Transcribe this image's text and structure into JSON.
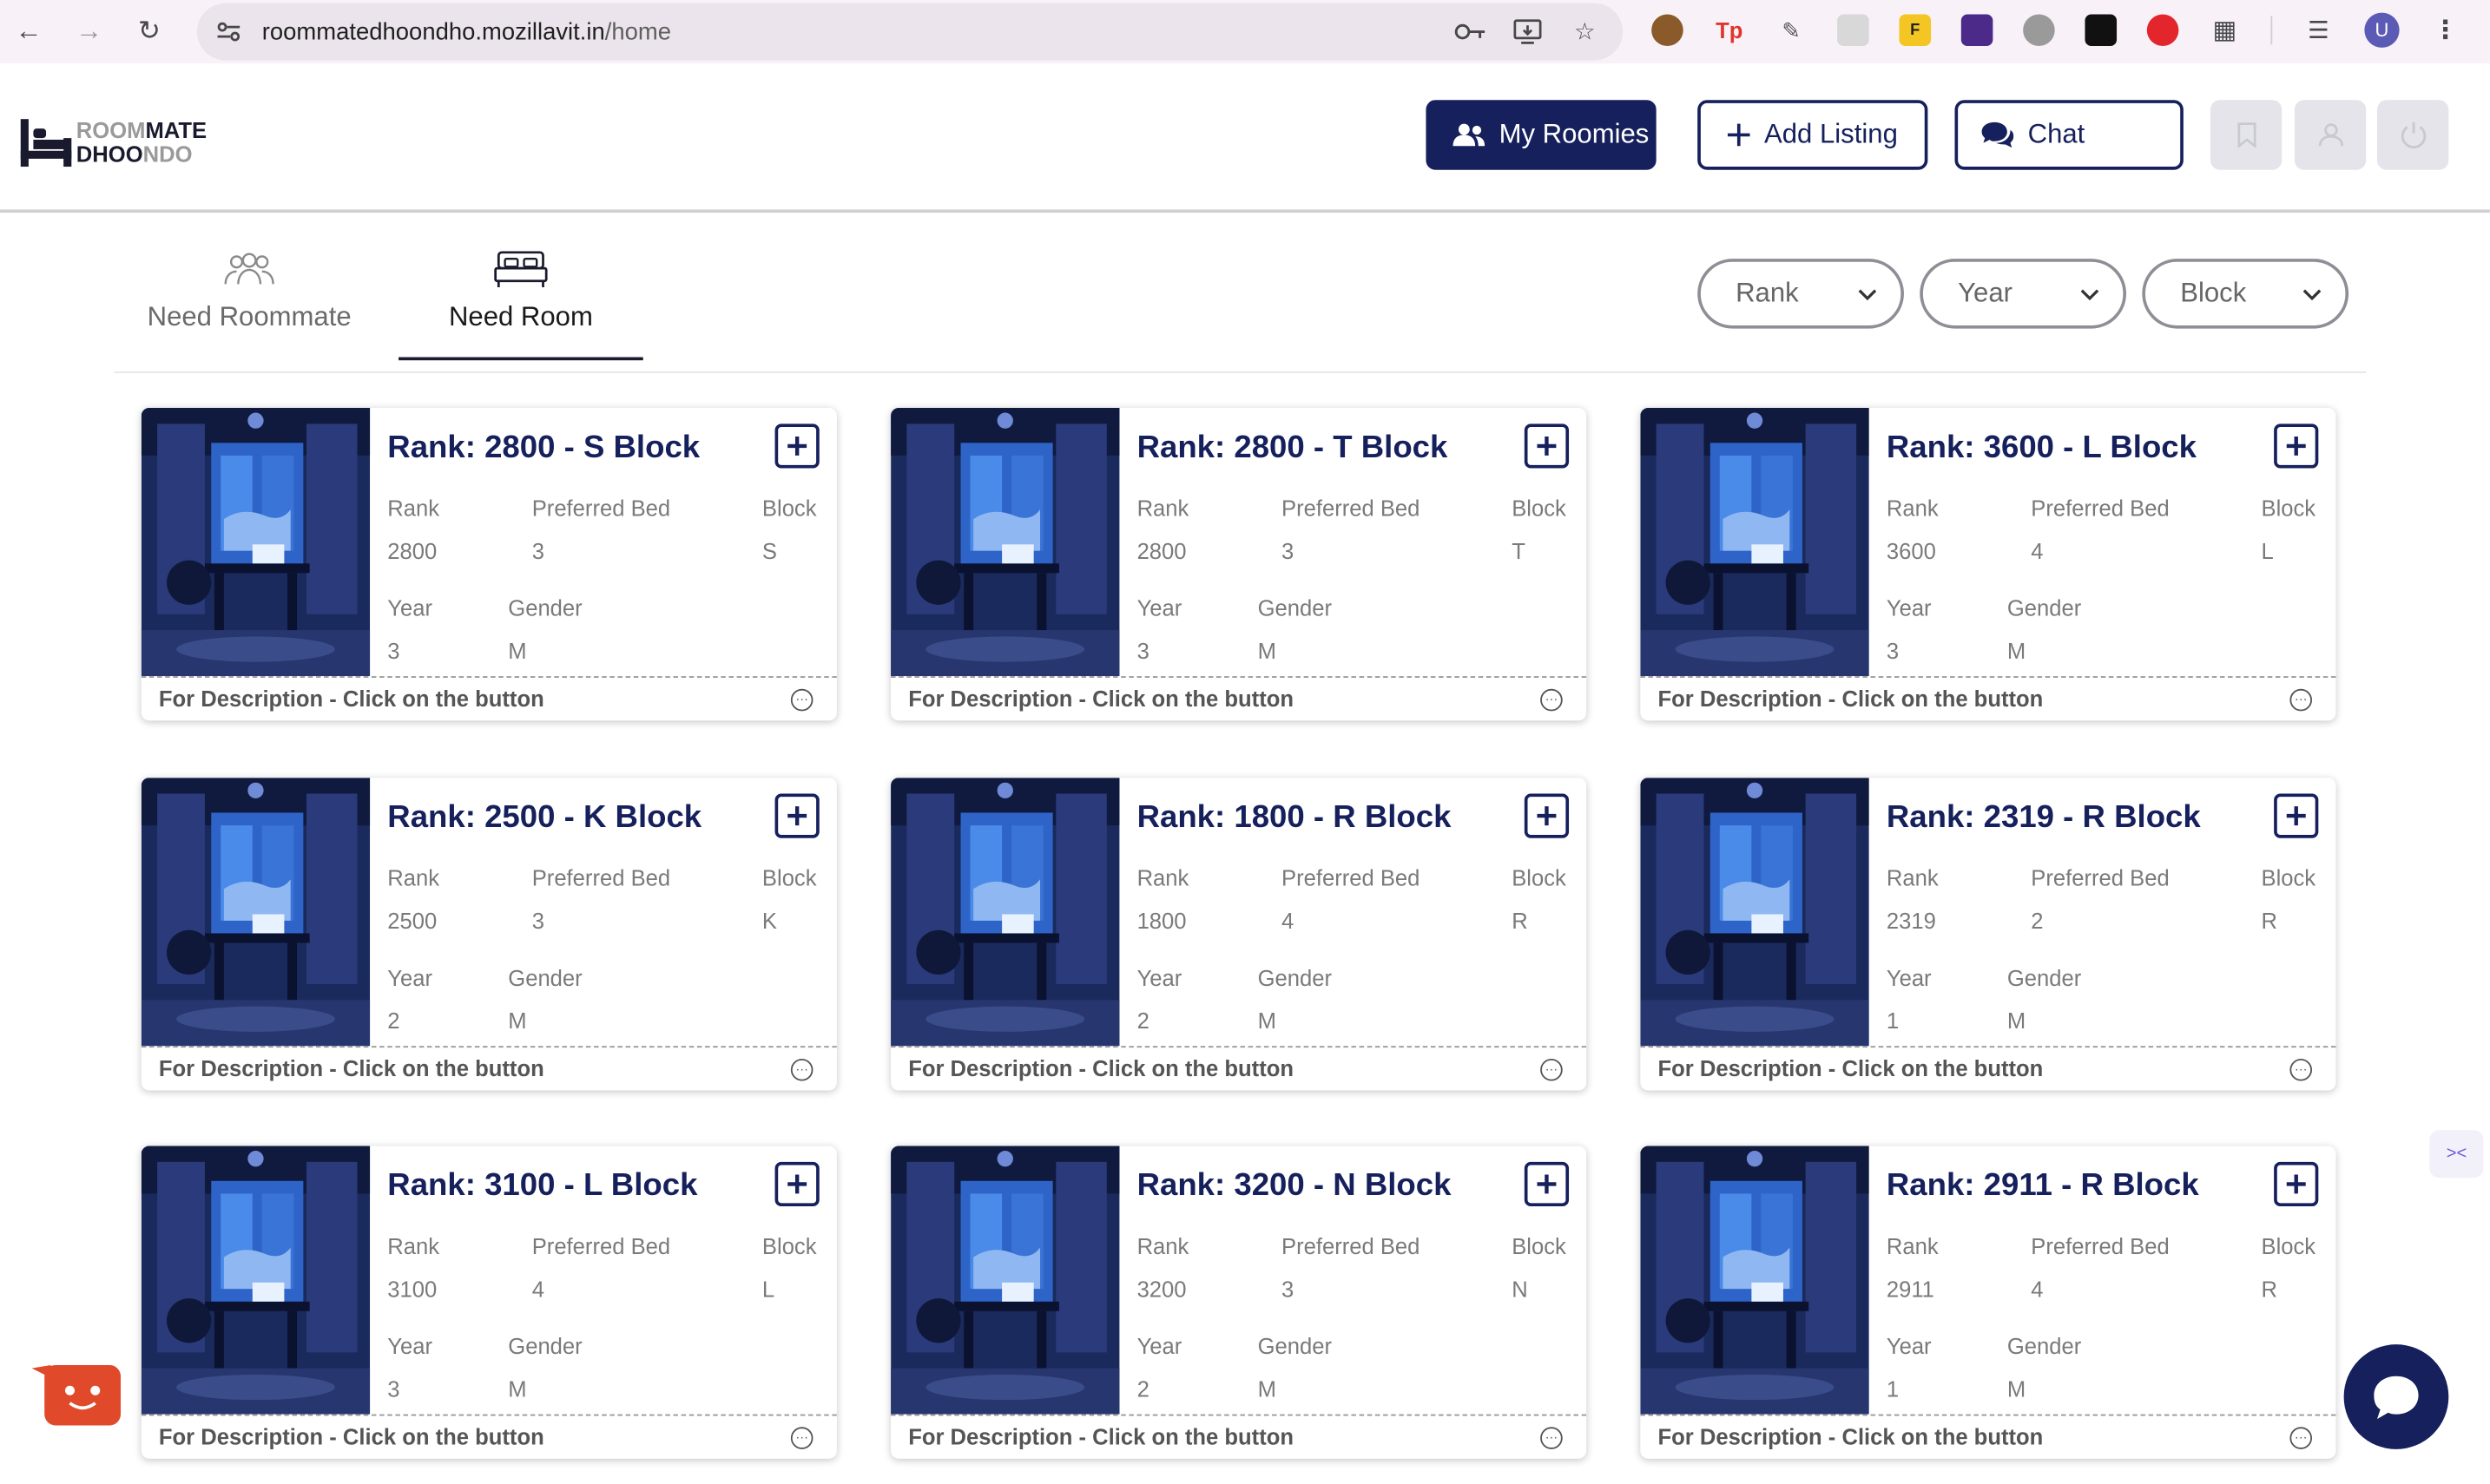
{
  "browser": {
    "url_host": "roommatedhoondho.mozillavit.in",
    "url_path": "/home",
    "profile_initial": "U"
  },
  "app": {
    "logo": {
      "line1_a": "ROOM",
      "line1_b": "MATE",
      "line2_a": "DHOO",
      "line2_b": "NDO"
    },
    "buttons": {
      "my_roomies": "My Roomies",
      "add_listing": "Add Listing",
      "chat": "Chat"
    },
    "colors": {
      "primary": "#15205c",
      "muted": "#e4e4ea"
    }
  },
  "tabs": [
    {
      "label": "Need Roommate",
      "active": false
    },
    {
      "label": "Need Room",
      "active": true
    }
  ],
  "filters": [
    {
      "label": "Rank"
    },
    {
      "label": "Year"
    },
    {
      "label": "Block"
    }
  ],
  "card_labels": {
    "rank": "Rank",
    "bed": "Preferred Bed",
    "block": "Block",
    "year": "Year",
    "gender": "Gender",
    "footer": "For Description - Click on the button"
  },
  "cards": [
    {
      "title": "Rank: 2800 - S Block",
      "rank": "2800",
      "bed": "3",
      "block": "S",
      "year": "3",
      "gender": "M"
    },
    {
      "title": "Rank: 2800 - T Block",
      "rank": "2800",
      "bed": "3",
      "block": "T",
      "year": "3",
      "gender": "M"
    },
    {
      "title": "Rank: 3600 - L Block",
      "rank": "3600",
      "bed": "4",
      "block": "L",
      "year": "3",
      "gender": "M"
    },
    {
      "title": "Rank: 2500 - K Block",
      "rank": "2500",
      "bed": "3",
      "block": "K",
      "year": "2",
      "gender": "M"
    },
    {
      "title": "Rank: 1800 - R Block",
      "rank": "1800",
      "bed": "4",
      "block": "R",
      "year": "2",
      "gender": "M"
    },
    {
      "title": "Rank: 2319 - R Block",
      "rank": "2319",
      "bed": "2",
      "block": "R",
      "year": "1",
      "gender": "M"
    },
    {
      "title": "Rank: 3100 - L Block",
      "rank": "3100",
      "bed": "4",
      "block": "L",
      "year": "3",
      "gender": "M"
    },
    {
      "title": "Rank: 3200 - N Block",
      "rank": "3200",
      "bed": "3",
      "block": "N",
      "year": "2",
      "gender": "M"
    },
    {
      "title": "Rank: 2911 - R Block",
      "rank": "2911",
      "bed": "4",
      "block": "R",
      "year": "1",
      "gender": "M"
    }
  ]
}
